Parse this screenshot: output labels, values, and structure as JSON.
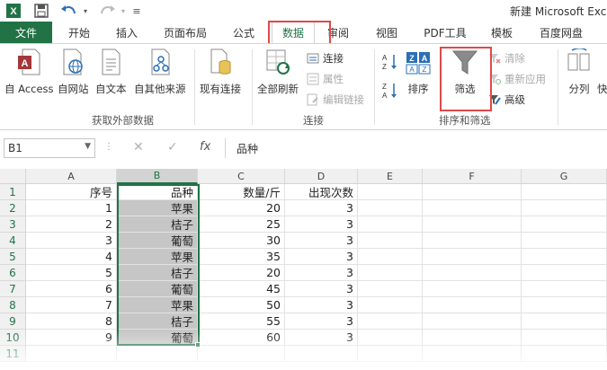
{
  "window": {
    "title": "新建 Microsoft Exc",
    "quick_access": {
      "dropdown_glyph": "≡"
    }
  },
  "tabs": [
    {
      "label": "文件"
    },
    {
      "label": "开始"
    },
    {
      "label": "插入"
    },
    {
      "label": "页面布局"
    },
    {
      "label": "公式"
    },
    {
      "label": "数据"
    },
    {
      "label": "审阅"
    },
    {
      "label": "视图"
    },
    {
      "label": "PDF工具"
    },
    {
      "label": "模板"
    },
    {
      "label": "百度网盘"
    }
  ],
  "ribbon": {
    "external": {
      "access": "自 Access",
      "web": "自网站",
      "text": "自文本",
      "other": "自其他来源",
      "label": "获取外部数据"
    },
    "existing_connections": "现有连接",
    "connections": {
      "refresh_all": "全部刷新",
      "connections": "连接",
      "properties": "属性",
      "edit_links": "编辑链接",
      "label": "连接"
    },
    "sort_filter": {
      "sort": "排序",
      "filter": "筛选",
      "clear": "清除",
      "reapply": "重新应用",
      "advanced": "高级",
      "label": "排序和筛选"
    },
    "split": "分列",
    "cut_off": "快"
  },
  "formula_bar": {
    "name_box": "B1",
    "cancel": "✕",
    "enter": "✓",
    "fx": "fx",
    "content": "品种"
  },
  "columns": [
    "A",
    "B",
    "C",
    "D",
    "E",
    "F",
    "G"
  ],
  "rows": [
    "1",
    "2",
    "3",
    "4",
    "5",
    "6",
    "7",
    "8",
    "9",
    "10",
    "11"
  ],
  "table": {
    "headers": [
      "序号",
      "品种",
      "数量/斤",
      "出现次数"
    ],
    "rows": [
      [
        "1",
        "苹果",
        "20",
        "3"
      ],
      [
        "2",
        "桔子",
        "25",
        "3"
      ],
      [
        "3",
        "葡萄",
        "30",
        "3"
      ],
      [
        "4",
        "苹果",
        "35",
        "3"
      ],
      [
        "5",
        "桔子",
        "20",
        "3"
      ],
      [
        "6",
        "葡萄",
        "45",
        "3"
      ],
      [
        "7",
        "苹果",
        "50",
        "3"
      ],
      [
        "8",
        "桔子",
        "55",
        "3"
      ],
      [
        "9",
        "葡萄",
        "60",
        "3"
      ]
    ]
  },
  "colors": {
    "accent": "#217346",
    "highlight_box": "#e0494a",
    "selection_fill": "#c6c6c6"
  }
}
